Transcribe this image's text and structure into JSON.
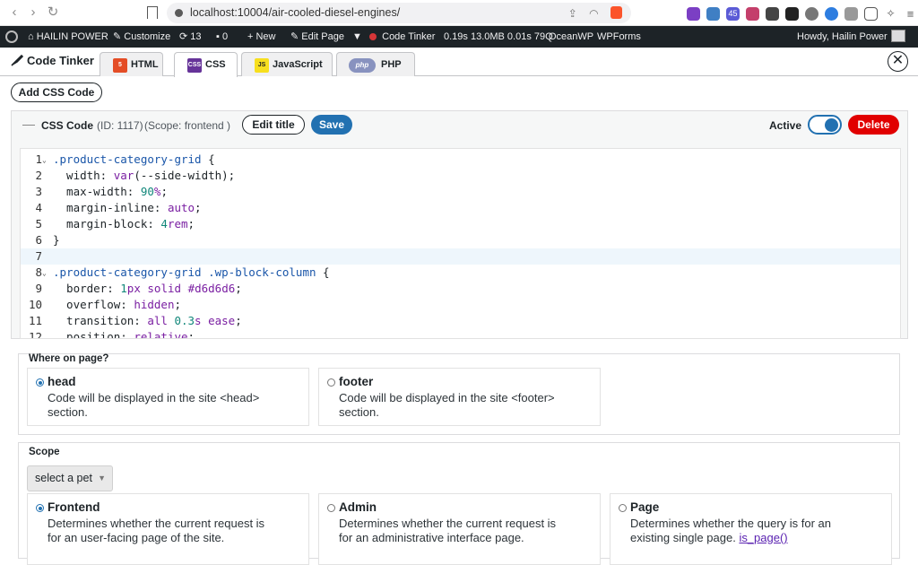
{
  "browser": {
    "url": "localhost:10004/air-cooled-diesel-engines/",
    "extensions": [
      "ext-1",
      "ext-2",
      "ext-3",
      "ext-4",
      "ext-5",
      "ext-6",
      "ext-7",
      "ext-8",
      "ext-9",
      "ext-10",
      "ext-11"
    ]
  },
  "admin_bar": {
    "site_name": "HAILIN POWER",
    "customize": "Customize",
    "updates": "13",
    "comments": "0",
    "new": "New",
    "edit_page": "Edit Page",
    "code_tinker": "Code Tinker",
    "stats": "0.19s  13.0MB  0.01s  79Q",
    "oceanwp": "OceanWP",
    "wpforms": "WPForms",
    "howdy": "Howdy, Hailin Power"
  },
  "tinker": {
    "brand": "Code Tinker",
    "tabs": [
      {
        "label": "HTML",
        "icon": "html5-icon"
      },
      {
        "label": "CSS",
        "icon": "css3-icon"
      },
      {
        "label": "JavaScript",
        "icon": "js-icon"
      },
      {
        "label": "PHP",
        "icon": "php-icon"
      }
    ],
    "add_button": "Add CSS Code"
  },
  "code_panel": {
    "title": "CSS Code",
    "id_text": "(ID: 1117)",
    "scope_text": "(Scope: frontend )",
    "edit_title": "Edit title",
    "save": "Save",
    "active_label": "Active",
    "delete": "Delete",
    "active": true
  },
  "where": {
    "title": "Where on page?",
    "options": [
      {
        "title": "head",
        "desc1": "Code will be displayed in the site <head>",
        "desc2": "section.",
        "selected": true
      },
      {
        "title": "footer",
        "desc1": "Code will be displayed in the site <footer>",
        "desc2": "section.",
        "selected": false
      }
    ]
  },
  "scope": {
    "title": "Scope",
    "select_value": "select a pet",
    "options": [
      {
        "title": "Frontend",
        "desc1": "Determines whether the current request is",
        "desc2": "for an user-facing page of the site.",
        "selected": true
      },
      {
        "title": "Admin",
        "desc1": "Determines whether the current request is",
        "desc2": "for an administrative interface page.",
        "selected": false
      },
      {
        "title": "Page",
        "desc1": "Determines whether the query is for an",
        "desc2": "existing single page.",
        "link": "is_page()",
        "selected": false
      }
    ]
  }
}
